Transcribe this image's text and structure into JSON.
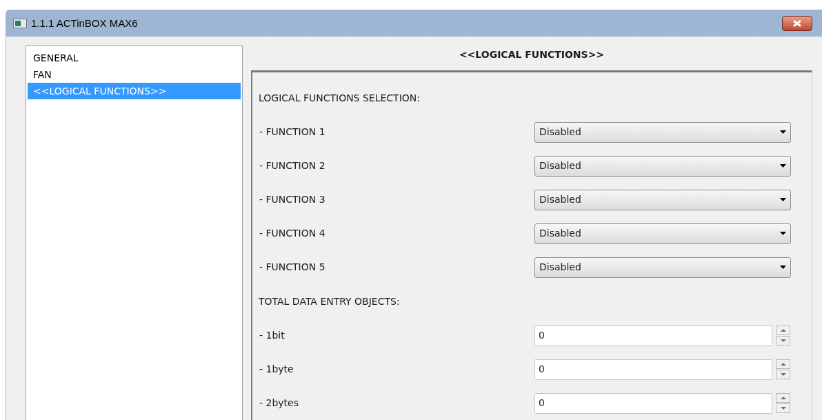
{
  "window": {
    "title": "1.1.1 ACTinBOX MAX6"
  },
  "sidebar": {
    "items": [
      {
        "label": "GENERAL",
        "selected": false
      },
      {
        "label": "FAN",
        "selected": false
      },
      {
        "label": "<<LOGICAL FUNCTIONS>>",
        "selected": true
      }
    ]
  },
  "panel": {
    "title": "<<LOGICAL FUNCTIONS>>",
    "sections": [
      {
        "heading": "LOGICAL FUNCTIONS SELECTION:",
        "fields": [
          {
            "label": "- FUNCTION 1",
            "kind": "dropdown",
            "value": "Disabled"
          },
          {
            "label": "- FUNCTION 2",
            "kind": "dropdown",
            "value": "Disabled"
          },
          {
            "label": "- FUNCTION 3",
            "kind": "dropdown",
            "value": "Disabled"
          },
          {
            "label": "- FUNCTION 4",
            "kind": "dropdown",
            "value": "Disabled"
          },
          {
            "label": "- FUNCTION 5",
            "kind": "dropdown",
            "value": "Disabled"
          }
        ]
      },
      {
        "heading": "TOTAL DATA ENTRY OBJECTS:",
        "fields": [
          {
            "label": "- 1bit",
            "kind": "spin",
            "value": "0"
          },
          {
            "label": "- 1byte",
            "kind": "spin",
            "value": "0"
          },
          {
            "label": "- 2bytes",
            "kind": "spin",
            "value": "0"
          }
        ]
      }
    ]
  }
}
